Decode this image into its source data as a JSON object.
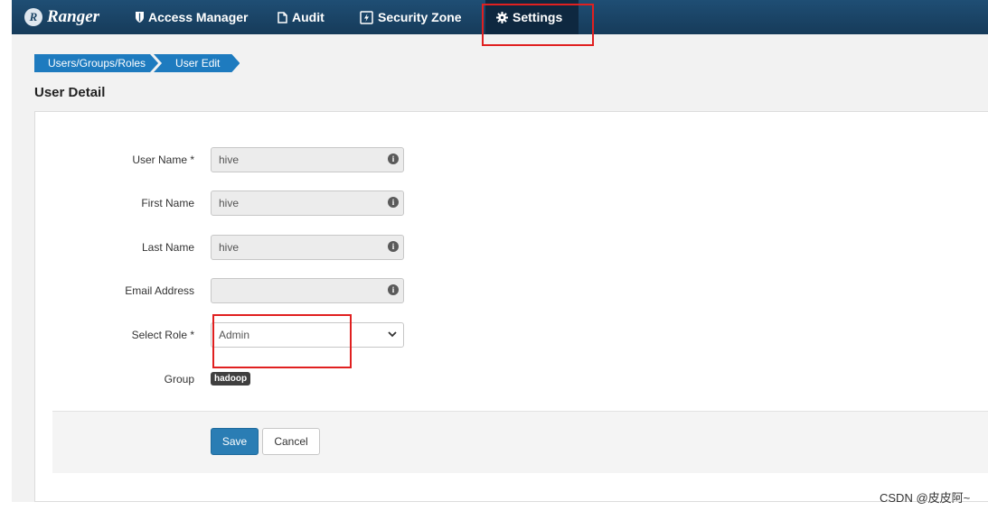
{
  "nav": {
    "brand": "Ranger",
    "brand_logo_letter": "R",
    "items": [
      {
        "label": "Access Manager",
        "icon": "shield-icon"
      },
      {
        "label": "Audit",
        "icon": "file-icon"
      },
      {
        "label": "Security Zone",
        "icon": "bolt-icon"
      },
      {
        "label": "Settings",
        "icon": "gear-icon",
        "active": true
      }
    ]
  },
  "breadcrumb": [
    "Users/Groups/Roles",
    "User Edit"
  ],
  "page_title": "User Detail",
  "form": {
    "user_name": {
      "label": "User Name *",
      "value": "hive"
    },
    "first_name": {
      "label": "First Name",
      "value": "hive"
    },
    "last_name": {
      "label": "Last Name",
      "value": "hive"
    },
    "email": {
      "label": "Email Address",
      "value": ""
    },
    "role": {
      "label": "Select Role *",
      "value": "Admin"
    },
    "group": {
      "label": "Group",
      "value": "hadoop"
    }
  },
  "actions": {
    "save": "Save",
    "cancel": "Cancel"
  },
  "watermark": "CSDN @皮皮阿~",
  "colors": {
    "nav_bg": "#1a4567",
    "accent": "#1e7bbf",
    "highlight": "#e02020"
  }
}
